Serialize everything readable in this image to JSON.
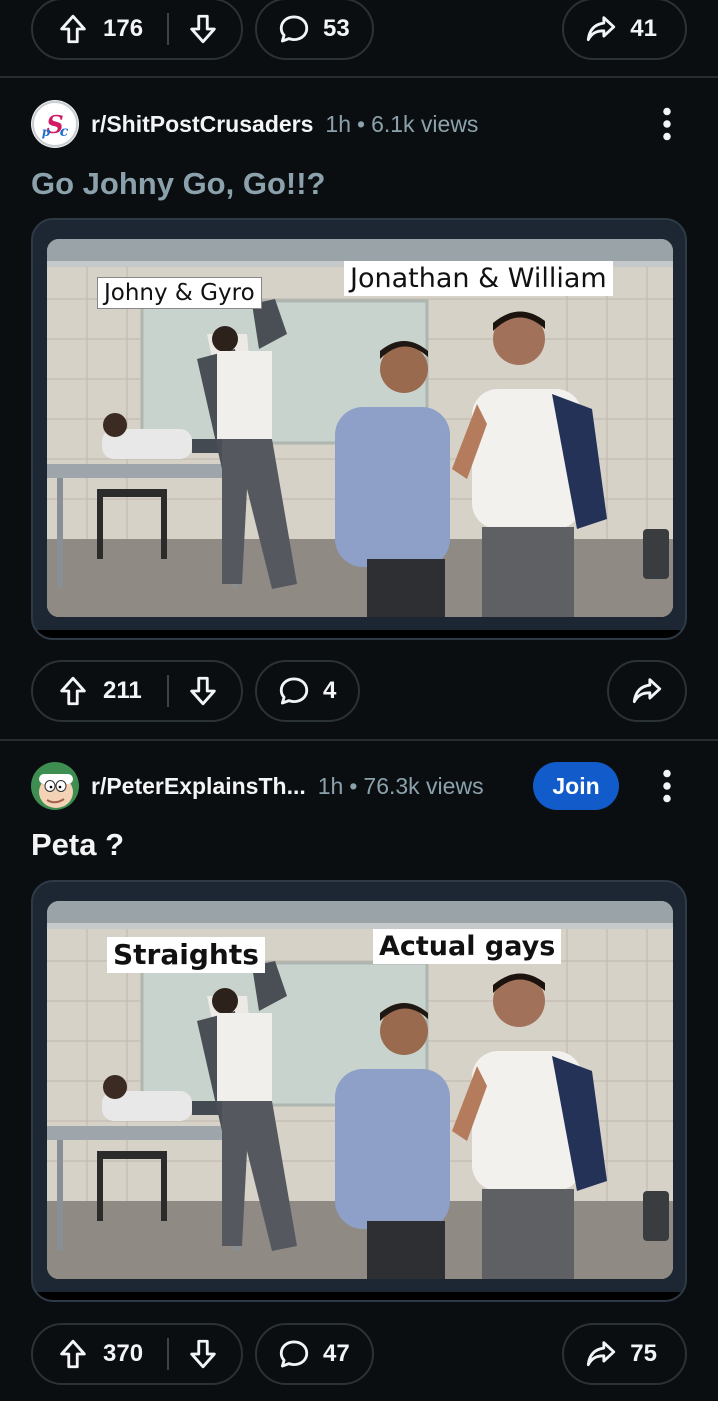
{
  "posts": [
    {
      "upvotes": "176",
      "comments": "53",
      "shares": "41"
    },
    {
      "subreddit": "r/ShitPostCrusaders",
      "age": "1h",
      "views": "6.1k views",
      "title": "Go Johny Go, Go!!?",
      "image_captions": [
        "Johny & Gyro",
        "Jonathan & William"
      ],
      "upvotes": "211",
      "comments": "4"
    },
    {
      "subreddit": "r/PeterExplainsTh...",
      "age": "1h",
      "views": "76.3k views",
      "join_label": "Join",
      "title": "Peta ?",
      "image_captions": [
        "Straights",
        "Actual gays"
      ],
      "upvotes": "370",
      "comments": "47",
      "shares": "75"
    }
  ],
  "separator": "•",
  "icons": {
    "upvote": "arrow-up-icon",
    "downvote": "arrow-down-icon",
    "comment": "speech-bubble-icon",
    "share": "share-arrow-icon",
    "more": "vertical-dots-icon"
  },
  "colors": {
    "background": "#0b0e11",
    "muted_text": "#8ba2ad",
    "join_button": "#115bca",
    "pill_border": "#2a3236"
  }
}
